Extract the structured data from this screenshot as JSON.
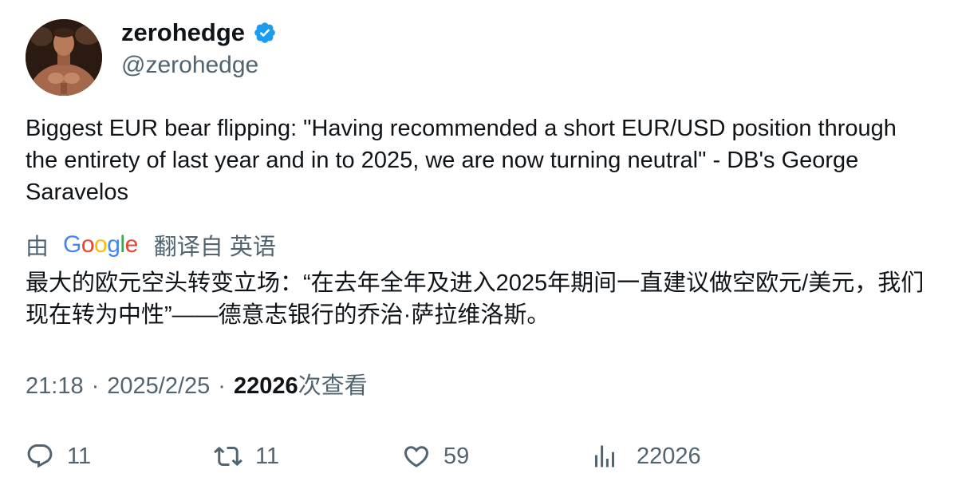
{
  "user": {
    "display_name": "zerohedge",
    "handle": "@zerohedge",
    "verified": true,
    "verified_color": "#1d9bf0"
  },
  "tweet": {
    "text": "Biggest EUR bear flipping: \"Having recommended a short EUR/USD position through the entirety of last year and in to 2025, we are now turning neutral\" - DB's George Saravelos"
  },
  "translation": {
    "by_label": "由",
    "provider": "Google",
    "link_label": "翻译自 英语",
    "text": "最大的欧元空头转变立场：“在去年全年及进入2025年期间一直建议做空欧元/美元，我们现在转为中性”——德意志银行的乔治·萨拉维洛斯。"
  },
  "meta": {
    "time": "21:18",
    "separator": "·",
    "date": "2025/2/25",
    "views_count": "22026",
    "views_label": "次查看"
  },
  "actions": {
    "reply_count": "11",
    "retweet_count": "11",
    "like_count": "59",
    "views_count": "22026",
    "icon_color": "#536471"
  }
}
